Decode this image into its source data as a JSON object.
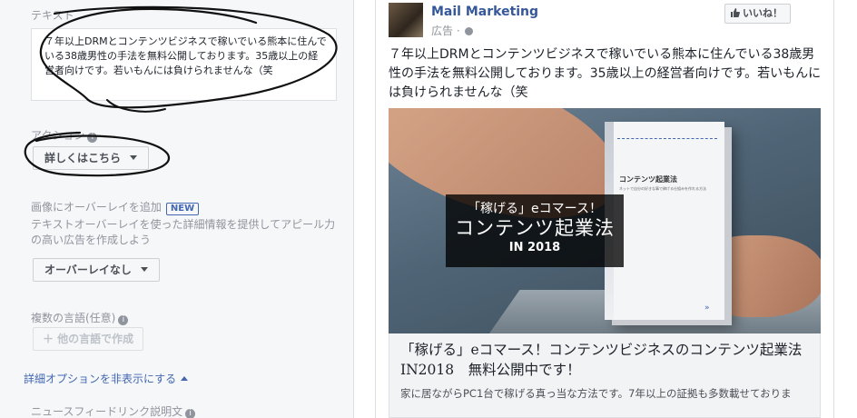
{
  "editor": {
    "text_label": "テキスト",
    "text_value": "７年以上DRMとコンテンツビジネスで稼いでいる熊本に住んでいる38歳男性の手法を無料公開しております。35歳以上の経営者向けです。若いもんには負けられませんな（笑",
    "action_label": "アクション",
    "cta_value": "詳しくはこちら",
    "overlay_heading": "画像にオーバーレイを追加",
    "new_badge": "NEW",
    "overlay_desc": "テキストオーバーレイを使った詳細情報を提供してアピール力の高い広告を作成しよう",
    "overlay_value": "オーバーレイなし",
    "lang_label": "複数の言語(任意)",
    "add_lang_button": "＋ 他の言語で作成",
    "advanced_toggle": "詳細オプションを非表示にする",
    "newsfeed_label": "ニュースフィードリンク説明文",
    "info_glyph": "i"
  },
  "preview": {
    "page_name": "Mail Marketing",
    "sponsored": "広告 ·",
    "like_button": "いいね！",
    "post_text": "７年以上DRMとコンテンツビジネスで稼いでいる熊本に住んでいる38歳男性の手法を無料公開しております。35歳以上の経営者向けです。若いもんには負けられませんな（笑",
    "image_overlay": {
      "line1": "「稼げる」eコマース！",
      "line2": "コンテンツ起業法",
      "line3": "IN 2018"
    },
    "book": {
      "title": "コンテンツ起業法",
      "subtitle": "ネットで自分の好きな事で稼げる仕組みを作れる方法"
    },
    "link_headline": "「稼げる」eコマース！コンテンツビジネスのコンテンツ起業法　IN2018　無料公開中です！",
    "link_description": "家に居ながらPC1台で稼げる真っ当な方法です。7年以上の証拠も多数載せておりま"
  },
  "colors": {
    "link": "#4267b2",
    "page_name": "#365899",
    "muted": "#90949c",
    "panel_bg": "#f6f7f9"
  }
}
